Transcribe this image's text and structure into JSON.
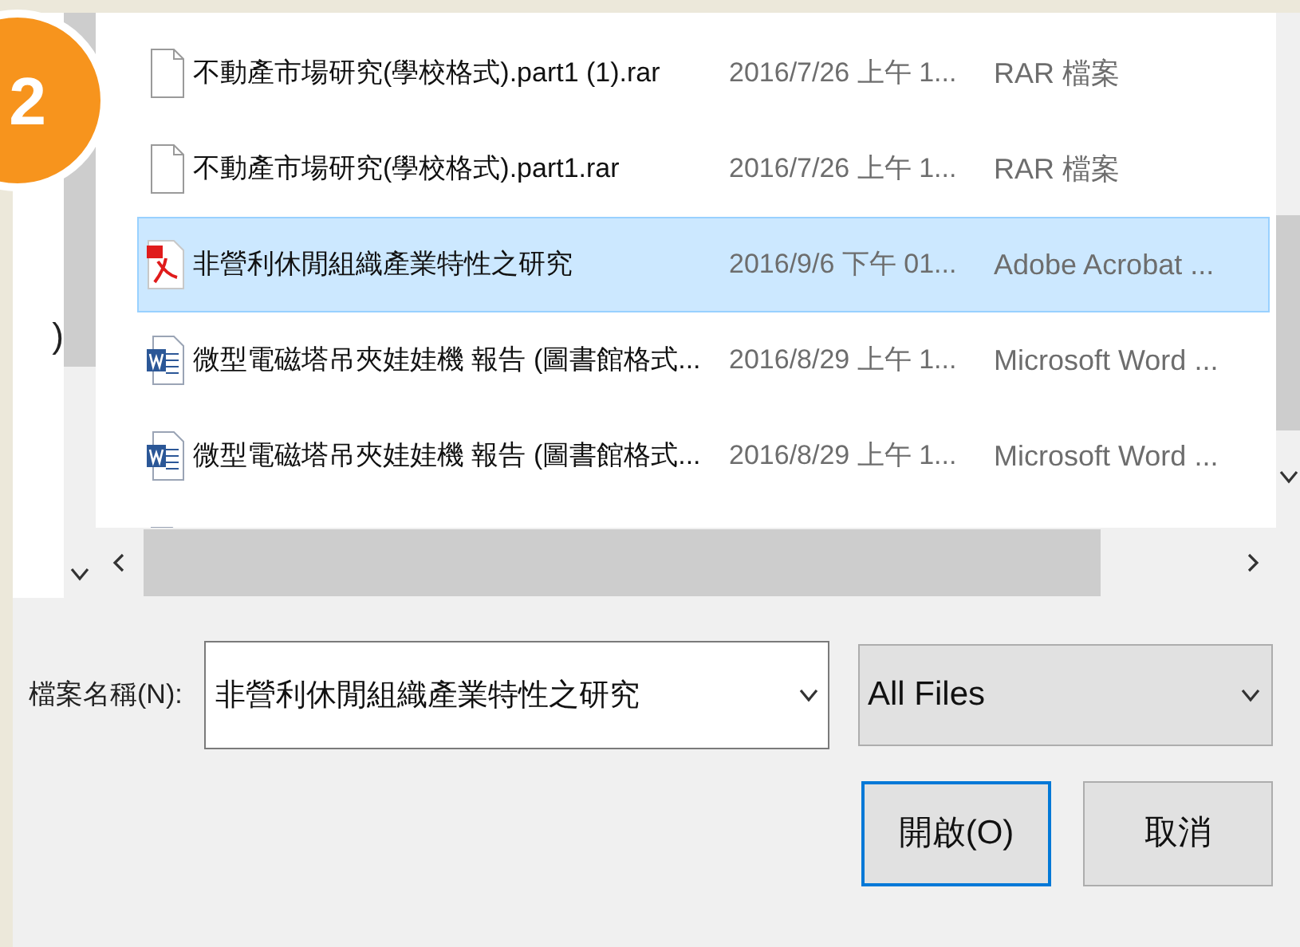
{
  "step_badge": {
    "text": "2"
  },
  "nav_pane": {
    "items": [
      {
        "label": ")"
      }
    ]
  },
  "files": [
    {
      "kind": "rar",
      "name": "不動產市場研究(學校格式).part1 (1).rar",
      "date": "2016/7/26 上午 1...",
      "type": "RAR 檔案",
      "selected": false
    },
    {
      "kind": "rar",
      "name": "不動產市場研究(學校格式).part1.rar",
      "date": "2016/7/26 上午 1...",
      "type": "RAR 檔案",
      "selected": false
    },
    {
      "kind": "pdf",
      "name": "非營利休閒組織產業特性之研究",
      "date": "2016/9/6 下午 01...",
      "type": "Adobe Acrobat ...",
      "selected": true
    },
    {
      "kind": "word",
      "name": "微型電磁塔吊夾娃娃機 報告 (圖書館格式...",
      "date": "2016/8/29 上午 1...",
      "type": "Microsoft Word ...",
      "selected": false
    },
    {
      "kind": "word",
      "name": "微型電磁塔吊夾娃娃機 報告 (圖書館格式...",
      "date": "2016/8/29 上午 1...",
      "type": "Microsoft Word ...",
      "selected": false
    }
  ],
  "file_name": {
    "label": "檔案名稱(N):",
    "value": "非營利休閒組織產業特性之研究"
  },
  "file_type": {
    "value": "All Files"
  },
  "buttons": [
    {
      "label": "開啟(O)",
      "kind": "primary"
    },
    {
      "label": "取消",
      "kind": "normal"
    }
  ]
}
